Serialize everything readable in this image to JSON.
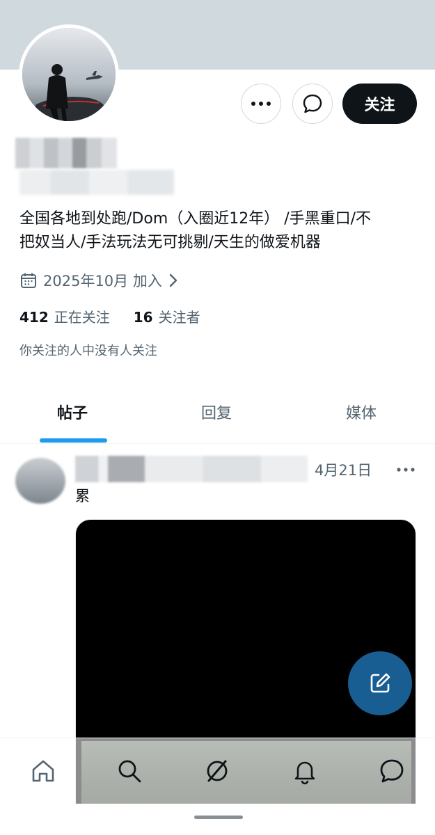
{
  "profile": {
    "bio": "全国各地到处跑/Dom（入圈近12年） /手黑重口/不\n把奴当人/手法玩法无可挑剔/天生的做爱机器",
    "joined": "2025年10月 加入",
    "following_count": "412",
    "following_label": "正在关注",
    "followers_count": "16",
    "followers_label": "关注者",
    "mutual_text": "你关注的人中没有人关注"
  },
  "actions": {
    "follow_label": "关注"
  },
  "tabs": [
    {
      "label": "帖子",
      "active": true
    },
    {
      "label": "回复",
      "active": false
    },
    {
      "label": "媒体",
      "active": false
    }
  ],
  "post": {
    "date": "4月21日",
    "text": "累"
  },
  "colors": {
    "banner": "#cfd9de",
    "accent": "#1d9bf0",
    "follow_button": "#0f1419",
    "secondary_text": "#536471"
  },
  "icons": {
    "more": "more-horizontal-icon",
    "message": "message-icon",
    "calendar": "calendar-icon",
    "chevron": "chevron-right-icon",
    "compose": "compose-icon",
    "nav": [
      "home-icon",
      "search-icon",
      "grok-icon",
      "bell-icon",
      "message-icon"
    ]
  }
}
